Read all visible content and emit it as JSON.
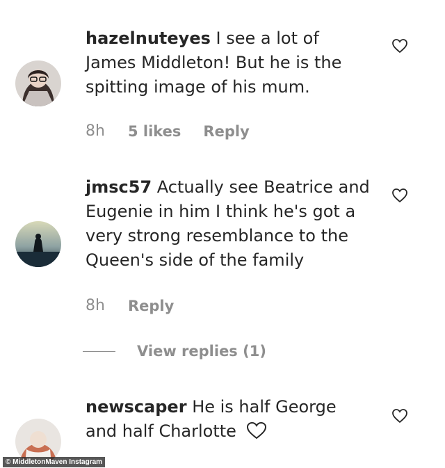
{
  "comments": [
    {
      "username": "hazelnuteyes",
      "text": "I see a lot of James Middleton! But he is the spitting image of his mum.",
      "time": "8h",
      "likes": "5 likes",
      "reply_label": "Reply"
    },
    {
      "username": "jmsc57",
      "text": "Actually see Beatrice and Eugenie in him I think he's got a very strong resemblance to the Queen's side of the family",
      "time": "8h",
      "reply_label": "Reply",
      "view_replies": "View replies (1)"
    },
    {
      "username": "newscaper",
      "text": "He is half George and half Charlotte"
    }
  ],
  "watermark": "© MiddletonMaven Instagram",
  "colors": {
    "text": "#262626",
    "meta": "#8e8e8e",
    "background": "#ffffff"
  }
}
